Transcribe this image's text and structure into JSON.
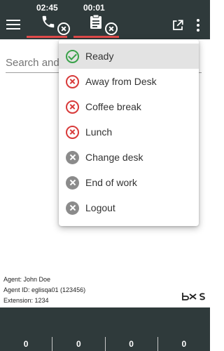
{
  "topbar": {
    "channels": [
      {
        "timer": "02:45",
        "icon": "phone-icon",
        "status": "unavailable"
      },
      {
        "timer": "00:01",
        "icon": "clipboard-icon",
        "status": "unavailable"
      }
    ]
  },
  "search": {
    "placeholder": "Search and c",
    "value": ""
  },
  "status_menu": {
    "items": [
      {
        "label": "Ready",
        "icon": "check-circle-icon",
        "selected": true
      },
      {
        "label": "Away from Desk",
        "icon": "cancel-circle-icon"
      },
      {
        "label": "Coffee break",
        "icon": "cancel-circle-icon"
      },
      {
        "label": "Lunch",
        "icon": "cancel-circle-icon"
      },
      {
        "label": "Change desk",
        "icon": "cancel-filled-icon"
      },
      {
        "label": "End of work",
        "icon": "cancel-filled-icon"
      },
      {
        "label": "Logout",
        "icon": "cancel-filled-icon"
      }
    ]
  },
  "agent": {
    "name_line": "Agent: John Doe",
    "id_line": "Agent ID: eglisqa01 (123456)",
    "extension_line": "Extension: 1234"
  },
  "footer": {
    "counters": [
      "0",
      "0",
      "0",
      "0"
    ]
  },
  "colors": {
    "bar": "#2f3a3b",
    "accent_red": "#e04a4a",
    "ready_green": "#3aa24a"
  }
}
